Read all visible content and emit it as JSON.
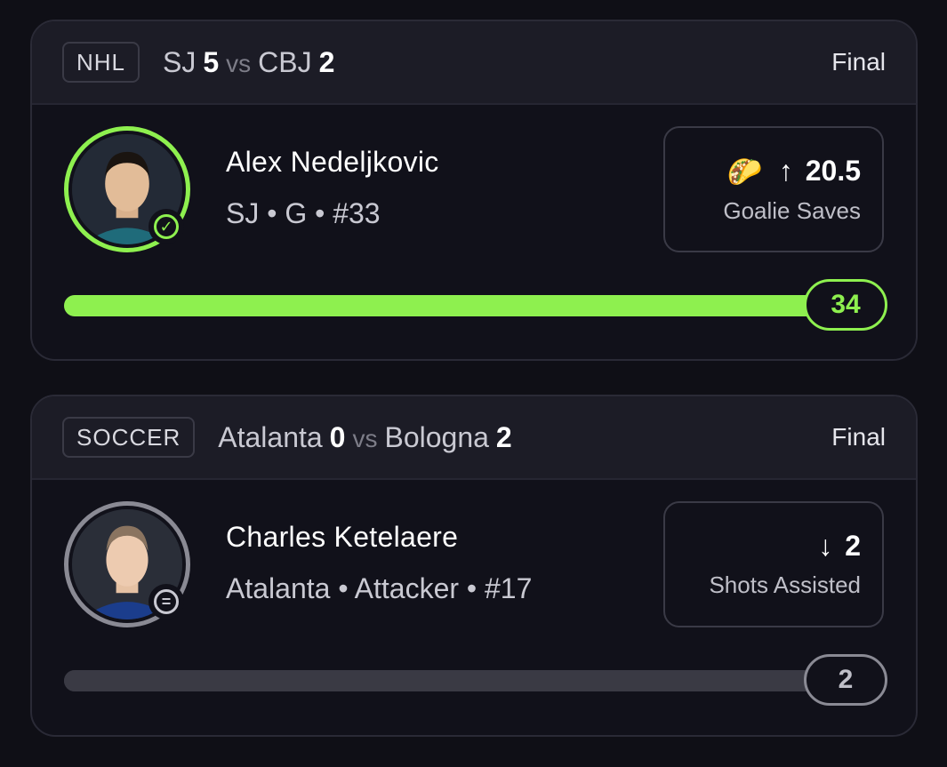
{
  "cards": [
    {
      "league": "NHL",
      "team1": "SJ",
      "score1": "5",
      "vs": "vs",
      "team2": "CBJ",
      "score2": "2",
      "status": "Final",
      "player_name": "Alex Nedeljkovic",
      "player_meta": "SJ • G • #33",
      "pick_emoji": "🌮",
      "pick_direction": "↑",
      "pick_line": "20.5",
      "pick_stat": "Goalie Saves",
      "result_value": "34",
      "progress_percent": 100,
      "accent_color": "#8ef04f",
      "avatar_status_icon": "check-icon"
    },
    {
      "league": "SOCCER",
      "team1": "Atalanta",
      "score1": "0",
      "vs": "vs",
      "team2": "Bologna",
      "score2": "2",
      "status": "Final",
      "player_name": "Charles Ketelaere",
      "player_meta": "Atalanta • Attacker • #17",
      "pick_direction": "↓",
      "pick_line": "2",
      "pick_stat": "Shots Assisted",
      "result_value": "2",
      "progress_percent": 100,
      "accent_color": "#8a8a94",
      "avatar_status_icon": "equal-icon"
    }
  ]
}
